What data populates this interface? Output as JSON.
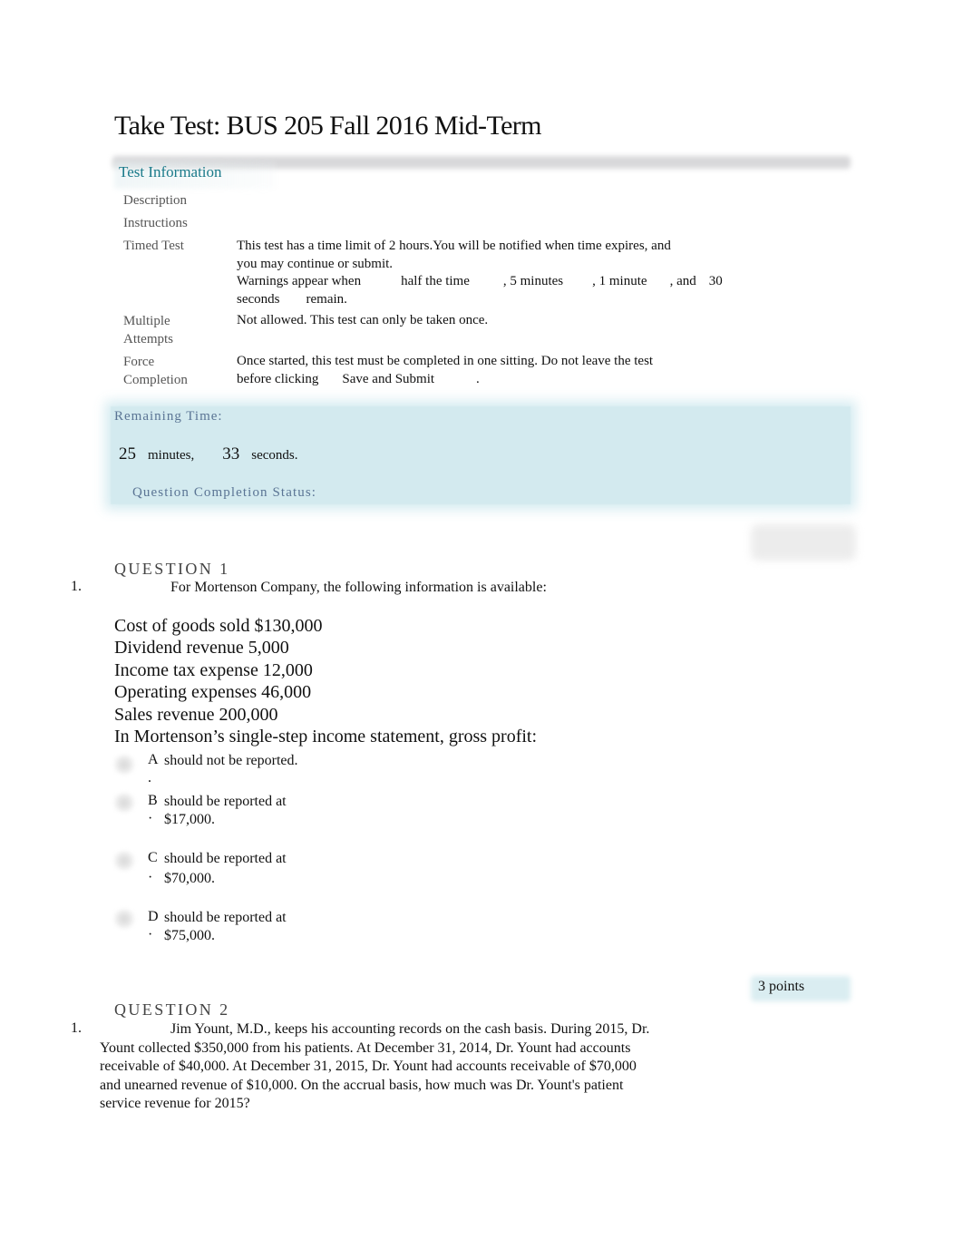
{
  "page": {
    "title": "Take Test: BUS 205 Fall 2016 Mid-Term"
  },
  "test_info": {
    "header": "Test Information",
    "rows": [
      {
        "label": "Description",
        "value": ""
      },
      {
        "label": "Instructions",
        "value": ""
      },
      {
        "label": "Timed Test",
        "value_line1": "This test has a time limit of 2 hours.You will be notified when time expires, and",
        "value_line2": "you may continue or submit.",
        "warnings_prefix": "Warnings appear when",
        "warnings_items": [
          "half the time",
          ", 5 minutes",
          ", 1 minute",
          ", and",
          "30"
        ],
        "warnings_line2_a": "seconds",
        "warnings_line2_b": "remain."
      },
      {
        "label_line1": "Multiple",
        "label_line2": "Attempts",
        "value": "Not allowed. This test can only be taken once."
      },
      {
        "label_line1": "Force",
        "label_line2": "Completion",
        "value_line1": "Once started, this test must be completed in one sitting. Do not leave the test",
        "value_line2_prefix": "before clicking",
        "value_line2_link": "Save and Submit",
        "value_line2_suffix": "."
      }
    ]
  },
  "timer": {
    "label": "Remaining Time:",
    "minutes": "25",
    "minutes_unit": "minutes,",
    "seconds": "33",
    "seconds_unit": "seconds.",
    "status_label": "Question Completion Status:"
  },
  "questions": [
    {
      "heading": "QUESTION 1",
      "number": "1.",
      "intro": "For Mortenson Company, the following information is available:",
      "data_lines": [
        "Cost of goods sold $130,000",
        "Dividend revenue 5,000",
        "Income tax expense 12,000",
        "Operating expenses 46,000",
        "Sales revenue 200,000",
        "In Mortenson’s single-step income statement, gross profit:"
      ],
      "options": [
        {
          "letter": "A",
          "dot": ".",
          "text_line1": "should not be reported.",
          "text_line2": ""
        },
        {
          "letter": "B",
          "dot": "·",
          "text_line1": "should be reported at",
          "text_line2": "$17,000."
        },
        {
          "letter": "C",
          "dot": "·",
          "text_line1": "should be reported at",
          "text_line2": "$70,000."
        },
        {
          "letter": "D",
          "dot": "·",
          "text_line1": "should be reported at",
          "text_line2": "$75,000."
        }
      ]
    },
    {
      "points": "3 points",
      "heading": "QUESTION 2",
      "number": "1.",
      "text_lines": [
        "Jim Yount, M.D., keeps his accounting records on the cash basis. During 2015, Dr.",
        "Yount collected $350,000 from his patients. At December 31, 2014, Dr. Yount had accounts",
        "receivable of $40,000. At December 31, 2015, Dr. Yount had accounts receivable of $70,000",
        "and unearned revenue of $10,000. On the accrual basis, how much was Dr. Yount's patient",
        "service revenue for 2015?"
      ]
    }
  ],
  "colors": {
    "info_header": "#1a7a8a",
    "timer_bg": "#d3eaef",
    "timer_label": "#5a7494"
  }
}
